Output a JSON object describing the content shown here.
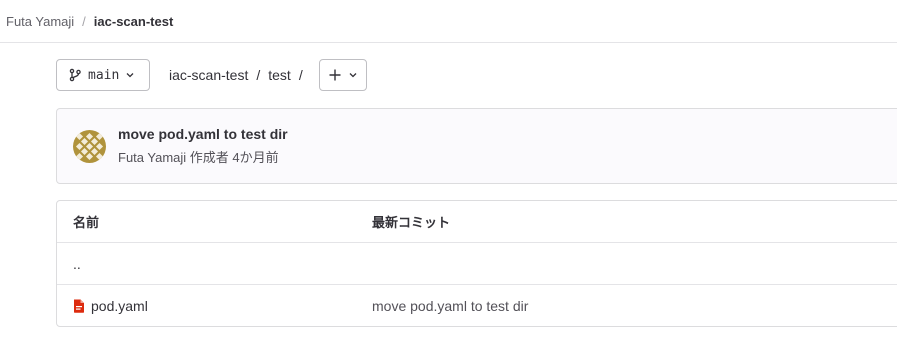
{
  "breadcrumb": {
    "owner": "Futa Yamaji",
    "separator": "/",
    "project": "iac-scan-test"
  },
  "toolbar": {
    "branch": "main",
    "path": [
      "iac-scan-test",
      "test"
    ],
    "path_separator": "/"
  },
  "commit": {
    "title": "move pod.yaml to test dir",
    "meta": "Futa Yamaji 作成者 4か月前"
  },
  "table": {
    "headers": {
      "name": "名前",
      "last_commit": "最新コミット"
    },
    "parent_row": "..",
    "files": [
      {
        "name": "pod.yaml",
        "commit": "move pod.yaml to test dir",
        "icon": "yaml-file-icon",
        "icon_color": "#dd2b0e"
      }
    ]
  },
  "colors": {
    "border": "#dcdcde",
    "commit_bg": "#fbfafd",
    "avatar": "#b0933c"
  }
}
